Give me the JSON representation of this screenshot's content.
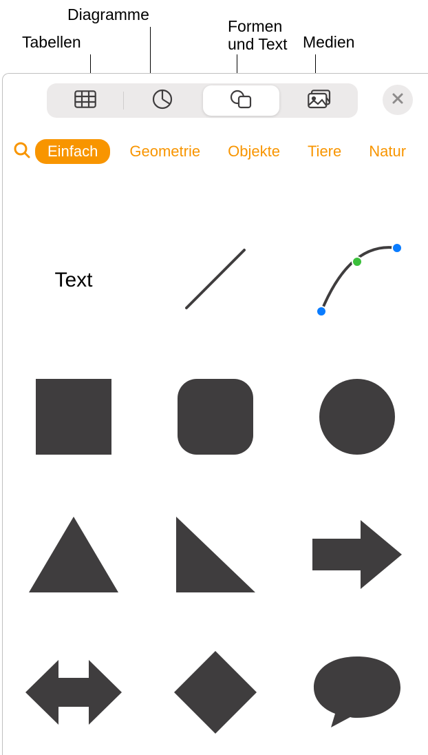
{
  "callouts": {
    "tables": "Tabellen",
    "charts": "Diagramme",
    "shapes_text": "Formen\nund Text",
    "media": "Medien"
  },
  "segments": {
    "tables": "tables",
    "charts": "charts",
    "shapes": "shapes",
    "media": "media"
  },
  "categories": {
    "active": "Einfach",
    "items": [
      "Geometrie",
      "Objekte",
      "Tiere",
      "Natur"
    ]
  },
  "shapes": {
    "text_label": "Text"
  },
  "colors": {
    "accent": "#f89500",
    "shape": "#3f3d3e"
  }
}
